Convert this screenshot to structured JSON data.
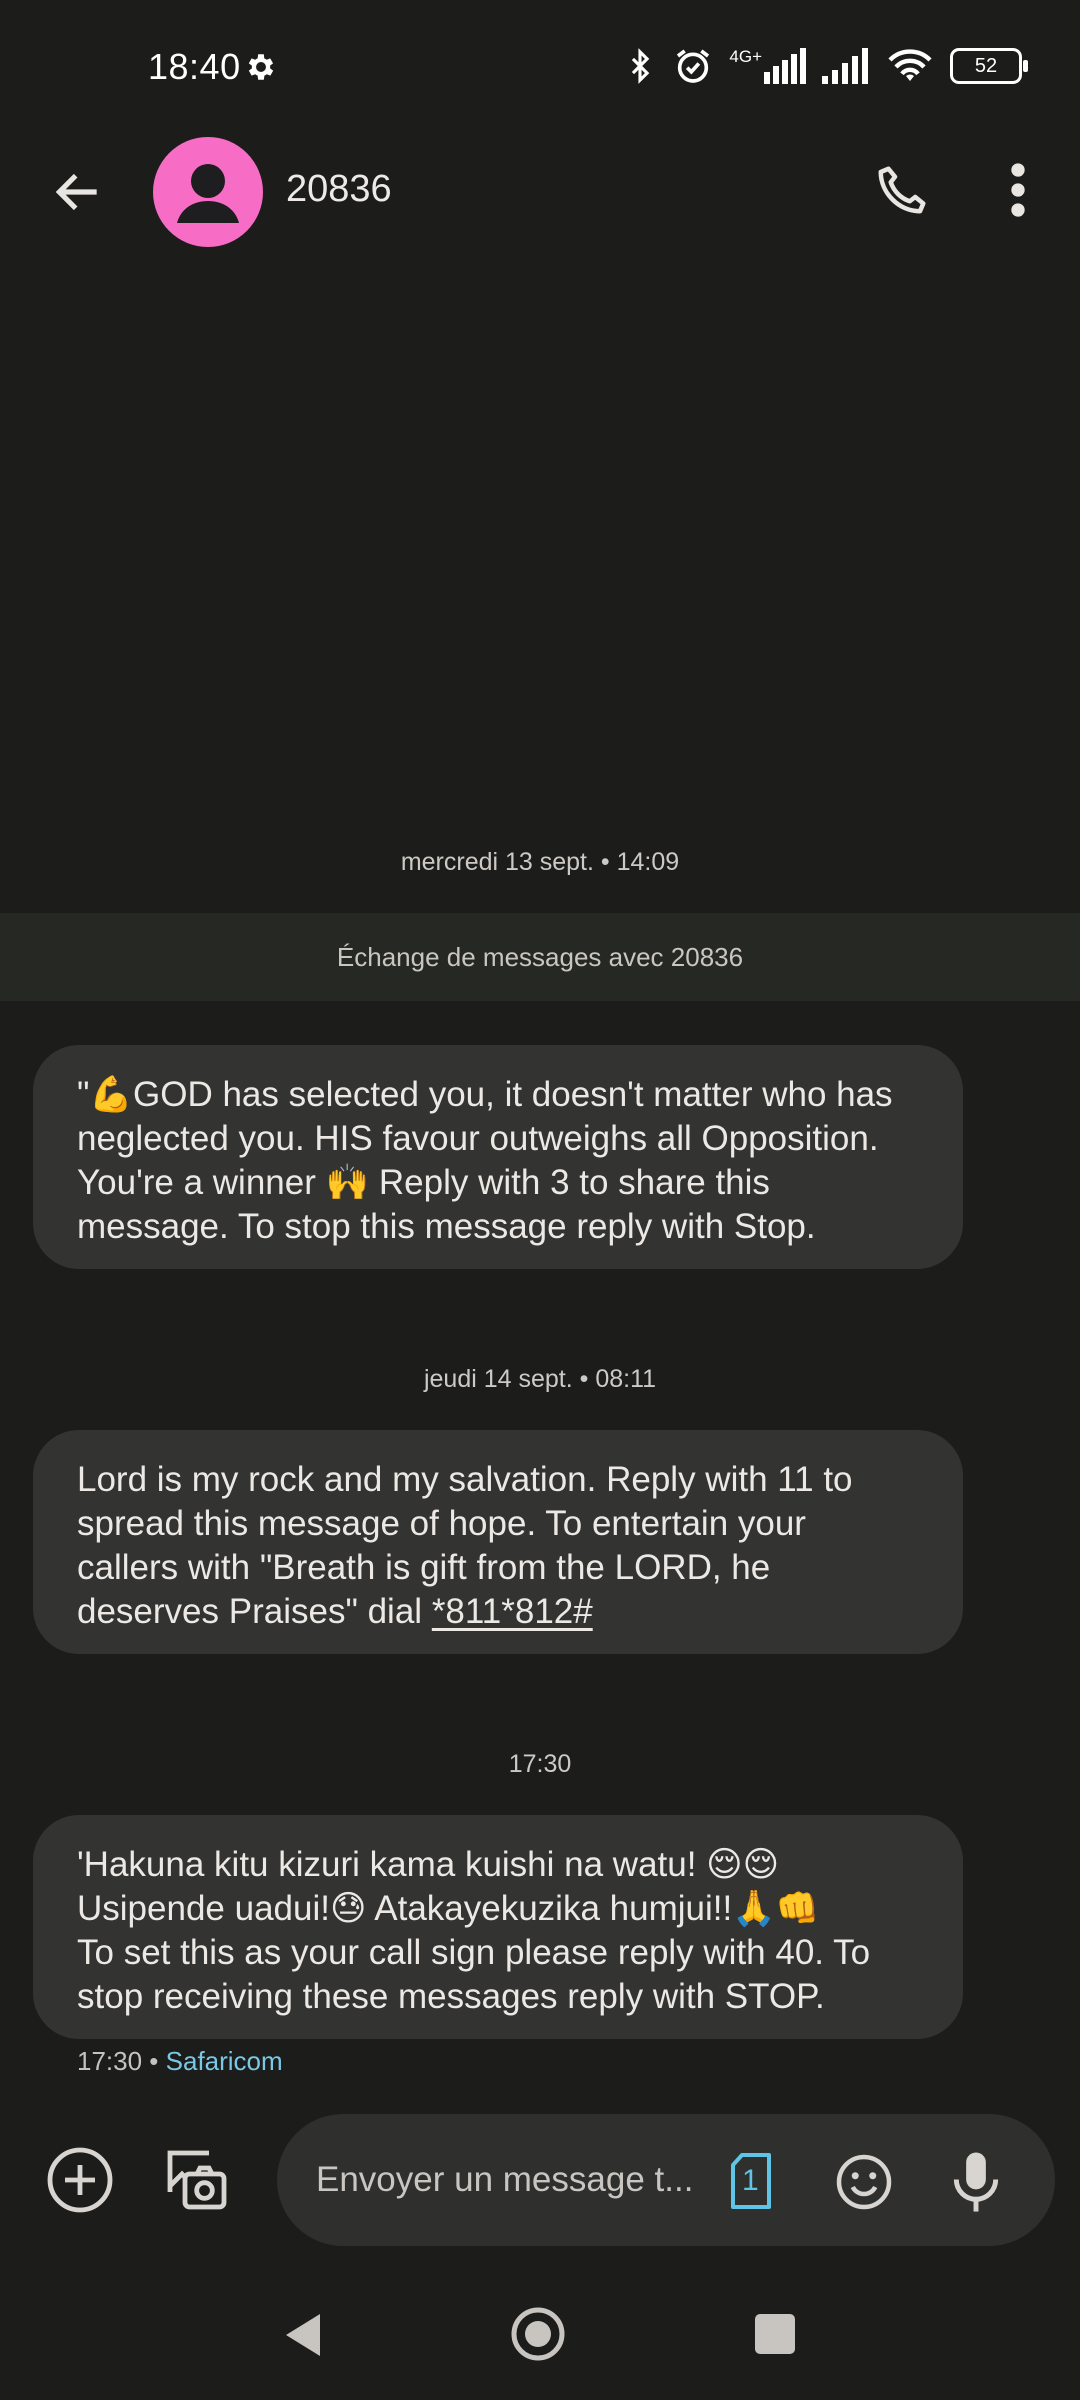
{
  "status_bar": {
    "time": "18:40",
    "network_label": "4G+",
    "battery": "52"
  },
  "header": {
    "contact_name": "20836"
  },
  "conversation": {
    "date1": "mercredi 13 sept. • 14:09",
    "exchange_banner": "Échange de messages avec 20836",
    "message1": {
      "line1": "\"💪GOD has selected you, it doesn't matter who has",
      "line2": "neglected you. HIS favour outweighs all Opposition.",
      "line3": "You're a winner 🙌 Reply with 3 to share this",
      "line4": "message. To stop this message reply with Stop."
    },
    "date2": "jeudi 14 sept. • 08:11",
    "message2": {
      "line1": "Lord is my rock and my salvation. Reply with 11 to",
      "line2": "spread this message of hope. To entertain your",
      "line3": "callers with \"Breath is gift from the LORD, he",
      "line4_prefix": "deserves Praises\" dial ",
      "ussd_code": "*811*812#"
    },
    "date3": "17:30",
    "message3": {
      "line1": "'Hakuna kitu kizuri kama kuishi na watu! 😌😌",
      "line2": "Usipende uadui!😓 Atakayekuzika humjui!!🙏👊",
      "line3": "To set this as your call sign please reply with 40. To",
      "line4": "stop receiving these messages reply with STOP."
    },
    "last_meta": {
      "time": "17:30",
      "separator": " • ",
      "carrier": "Safaricom"
    }
  },
  "compose": {
    "placeholder": "Envoyer un message t...",
    "sim_number": "1"
  },
  "colors": {
    "background": "#1c1d1b",
    "bubble": "#333432",
    "avatar": "#f76cc5",
    "carrier_link": "#7ac8e6",
    "sim_icon": "#5fc4e6"
  },
  "icons": [
    "settings-gear-icon",
    "bluetooth-icon",
    "alarm-icon",
    "signal-icon",
    "wifi-icon",
    "battery-icon",
    "back-arrow-icon",
    "avatar-person-icon",
    "phone-icon",
    "more-vert-icon",
    "add-circle-icon",
    "gallery-camera-icon",
    "sim-card-icon",
    "emoji-icon",
    "microphone-icon",
    "nav-back-icon",
    "nav-home-icon",
    "nav-recents-icon"
  ]
}
